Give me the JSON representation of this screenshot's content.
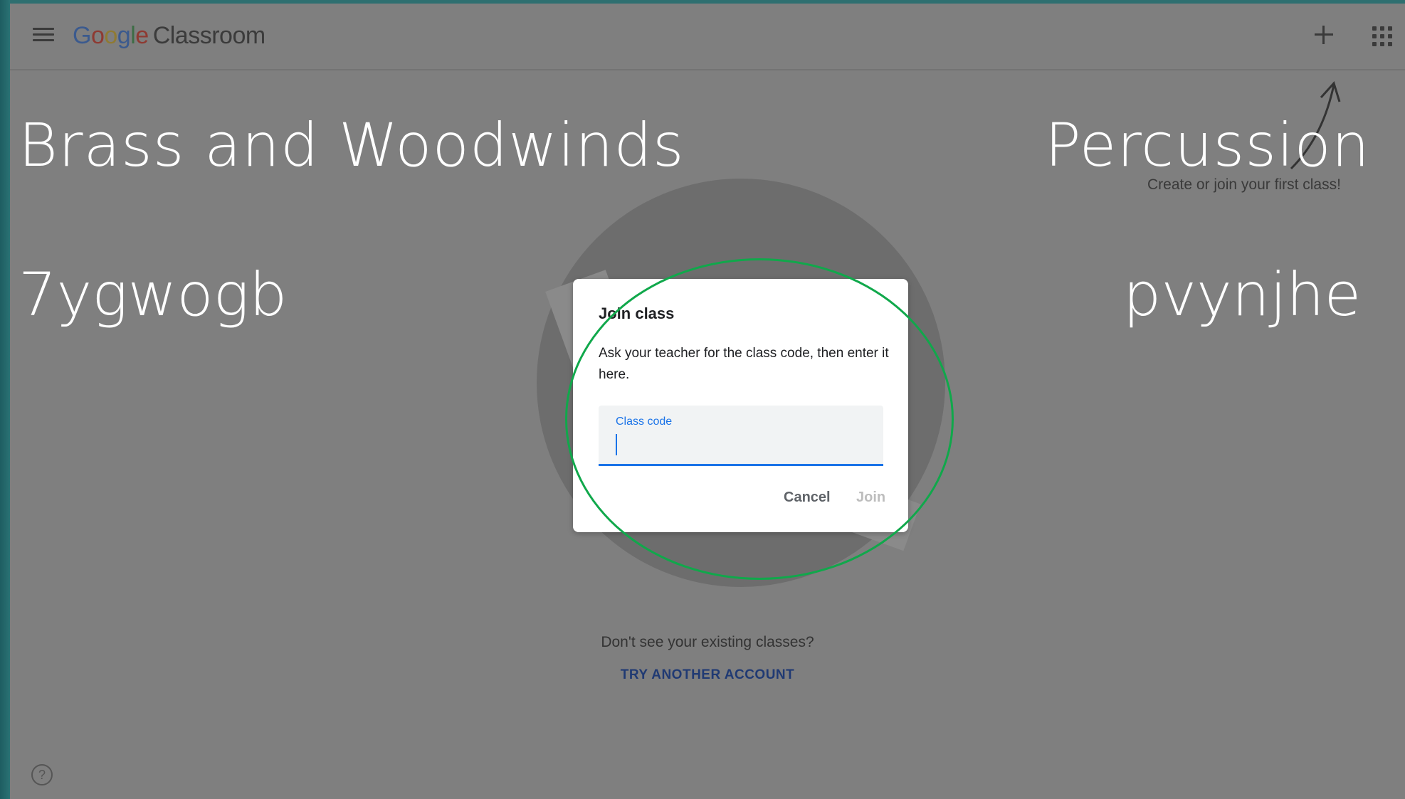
{
  "header": {
    "logo_google": [
      "G",
      "o",
      "o",
      "g",
      "l",
      "e"
    ],
    "logo_product": "Classroom",
    "icons": {
      "menu": "hamburger-menu-icon",
      "add": "plus-icon",
      "apps": "apps-grid-icon"
    }
  },
  "overlay": {
    "left_title": "Brass and Woodwinds",
    "right_title": "Percussion",
    "left_code": "7ygwogb",
    "right_code": "pvynjhe",
    "hint": "Create or join your first class!"
  },
  "dialog": {
    "title": "Join class",
    "description": "Ask your teacher for the class code, then enter it here.",
    "field_label": "Class code",
    "field_value": "",
    "cancel_label": "Cancel",
    "join_label": "Join"
  },
  "footer": {
    "missing_text": "Don't see your existing classes?",
    "try_link": "TRY ANOTHER ACCOUNT",
    "help_glyph": "?"
  },
  "colors": {
    "accent": "#1a73e8",
    "highlight": "#10a84b",
    "dim_background": "#7f7f7f"
  }
}
